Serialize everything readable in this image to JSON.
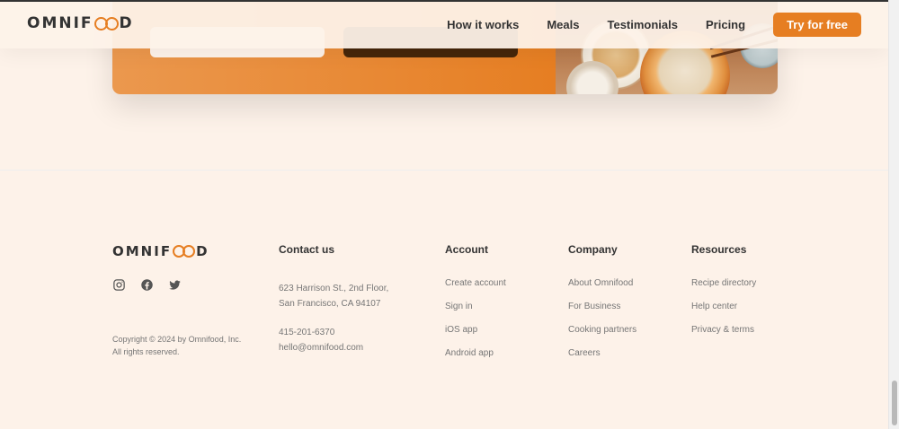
{
  "brand": {
    "logo_prefix": "OMNIF",
    "logo_suffix": "D",
    "accent": "#e67e22",
    "background": "#fdf2e9"
  },
  "header": {
    "nav": [
      {
        "label": "How it works"
      },
      {
        "label": "Meals"
      },
      {
        "label": "Testimonials"
      },
      {
        "label": "Pricing"
      }
    ],
    "cta_label": "Try for free"
  },
  "footer": {
    "socials": [
      "instagram-icon",
      "facebook-icon",
      "twitter-icon"
    ],
    "copyright": "Copyright © 2024 by Omnifood, Inc. All rights reserved.",
    "contact": {
      "title": "Contact us",
      "address_line1": "623 Harrison St., 2nd Floor,",
      "address_line2": "San Francisco, CA 94107",
      "phone": "415-201-6370",
      "email": "hello@omnifood.com"
    },
    "account": {
      "title": "Account",
      "links": [
        "Create account",
        "Sign in",
        "iOS app",
        "Android app"
      ]
    },
    "company": {
      "title": "Company",
      "links": [
        "About Omnifood",
        "For Business",
        "Cooking partners",
        "Careers"
      ]
    },
    "resources": {
      "title": "Resources",
      "links": [
        "Recipe directory",
        "Help center",
        "Privacy & terms"
      ]
    }
  }
}
